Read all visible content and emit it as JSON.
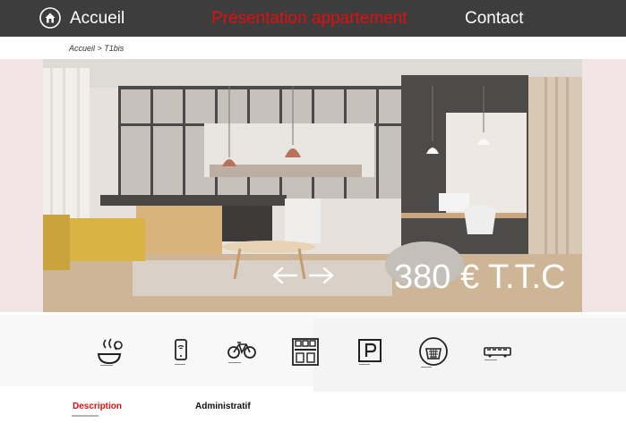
{
  "navbar": {
    "home_label": "Accueil",
    "presentation_label": "Présentation appartement",
    "contact_label": "Contact",
    "home_icon": "home-circle-icon"
  },
  "breadcrumb": {
    "home": "Accueil",
    "separator": " > ",
    "current": "T1bis"
  },
  "hero": {
    "price": "380 € T.T.C",
    "prev_icon": "arrow-left-icon",
    "next_icon": "arrow-right-icon"
  },
  "amenities": [
    {
      "icon": "kitchen-icon"
    },
    {
      "icon": "phone-wifi-icon"
    },
    {
      "icon": "bicycle-icon"
    },
    {
      "icon": "appliances-icon"
    },
    {
      "icon": "parking-icon"
    },
    {
      "icon": "laundry-basket-icon"
    },
    {
      "icon": "bus-icon"
    }
  ],
  "tabs": {
    "description_label": "Description",
    "administratif_label": "Administratif"
  },
  "colors": {
    "navbar_bg": "#3d3d3d",
    "accent_red": "#e10f0f",
    "hero_band": "#f1e5e5"
  }
}
